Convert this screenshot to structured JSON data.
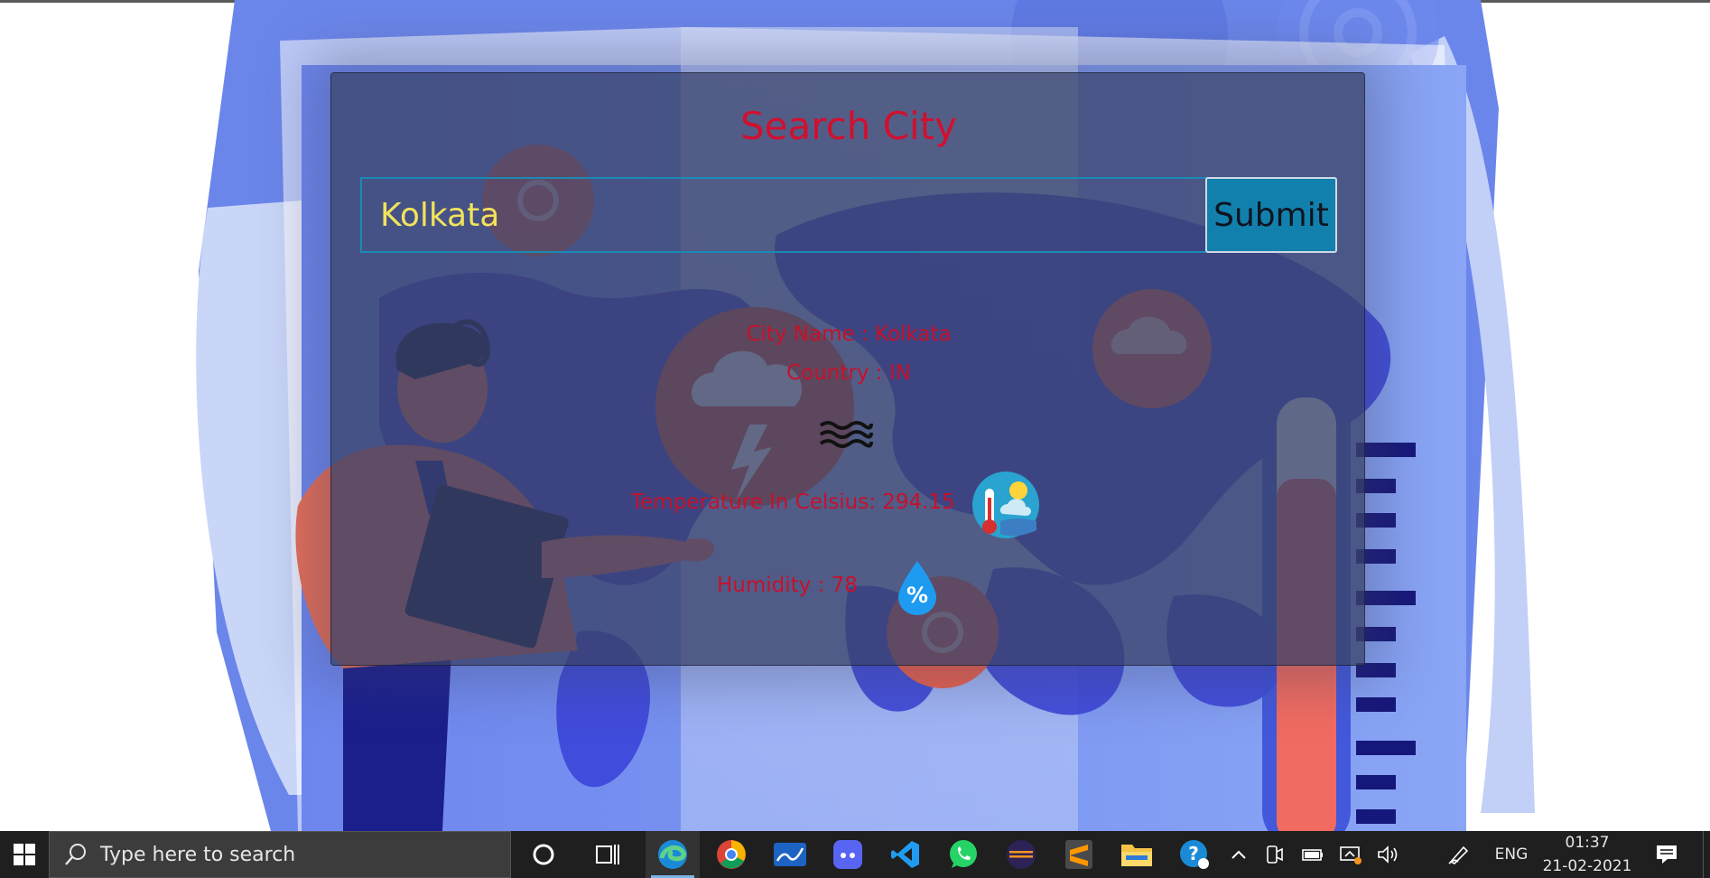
{
  "card": {
    "title": "Search City",
    "search_value": "Kolkata",
    "submit_label": "Submit",
    "city_name_text": "City Name : Kolkata",
    "country_text": "Country : IN",
    "temperature_text": "Temperature In Celsius: 294.15",
    "humidity_text": "Humidity : 78",
    "humidity_icon_symbol": "%",
    "wind_icon": "wind-waves-icon",
    "thermometer_icon": "thermometer-sun-icon"
  },
  "colors": {
    "title_red": "#d0102e",
    "input_text_yellow": "#f2e35c",
    "accent_blue": "#1280ad",
    "card_bg": "#3a4268"
  },
  "taskbar": {
    "search_placeholder": "Type here to search",
    "pinned_icons": [
      "cortana-icon",
      "task-view-icon",
      "edge-icon",
      "chrome-icon",
      "whiteboard-icon",
      "discord-icon",
      "vscode-icon",
      "whatsapp-icon",
      "eclipse-icon",
      "sublime-text-icon",
      "file-explorer-icon",
      "help-icon"
    ],
    "active_app": "edge-icon",
    "tray_icons": [
      "show-hidden-icons-chevron",
      "meet-now-icon",
      "battery-icon",
      "network-icon",
      "volume-icon",
      "pen-icon"
    ],
    "language": "ENG",
    "time": "01:37",
    "date": "21-02-2021"
  }
}
